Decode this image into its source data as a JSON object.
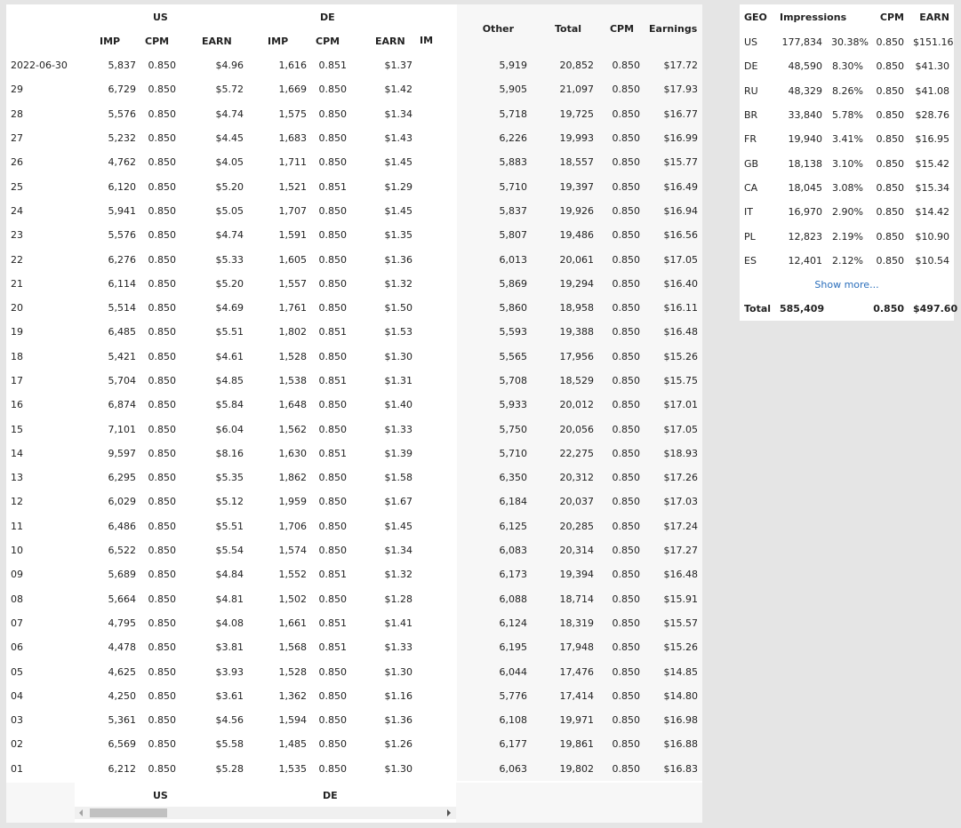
{
  "main": {
    "group_headers": {
      "us": "US",
      "de": "DE",
      "other_trunc": "IM"
    },
    "col_headers": {
      "us_imp": "IMP",
      "us_cpm": "CPM",
      "us_earn": "EARN",
      "de_imp": "IMP",
      "de_cpm": "CPM",
      "de_earn": "EARN",
      "other": "Other",
      "total": "Total",
      "cpm": "CPM",
      "earnings": "Earnings"
    },
    "rows": [
      {
        "date": "2022-06-30",
        "us_imp": "5,837",
        "us_cpm": "0.850",
        "us_earn": "$4.96",
        "de_imp": "1,616",
        "de_cpm": "0.851",
        "de_earn": "$1.37",
        "other": "5,919",
        "total": "20,852",
        "cpm": "0.850",
        "earnings": "$17.72"
      },
      {
        "date": "29",
        "us_imp": "6,729",
        "us_cpm": "0.850",
        "us_earn": "$5.72",
        "de_imp": "1,669",
        "de_cpm": "0.850",
        "de_earn": "$1.42",
        "other": "5,905",
        "total": "21,097",
        "cpm": "0.850",
        "earnings": "$17.93"
      },
      {
        "date": "28",
        "us_imp": "5,576",
        "us_cpm": "0.850",
        "us_earn": "$4.74",
        "de_imp": "1,575",
        "de_cpm": "0.850",
        "de_earn": "$1.34",
        "other": "5,718",
        "total": "19,725",
        "cpm": "0.850",
        "earnings": "$16.77"
      },
      {
        "date": "27",
        "us_imp": "5,232",
        "us_cpm": "0.850",
        "us_earn": "$4.45",
        "de_imp": "1,683",
        "de_cpm": "0.850",
        "de_earn": "$1.43",
        "other": "6,226",
        "total": "19,993",
        "cpm": "0.850",
        "earnings": "$16.99"
      },
      {
        "date": "26",
        "us_imp": "4,762",
        "us_cpm": "0.850",
        "us_earn": "$4.05",
        "de_imp": "1,711",
        "de_cpm": "0.850",
        "de_earn": "$1.45",
        "other": "5,883",
        "total": "18,557",
        "cpm": "0.850",
        "earnings": "$15.77"
      },
      {
        "date": "25",
        "us_imp": "6,120",
        "us_cpm": "0.850",
        "us_earn": "$5.20",
        "de_imp": "1,521",
        "de_cpm": "0.851",
        "de_earn": "$1.29",
        "other": "5,710",
        "total": "19,397",
        "cpm": "0.850",
        "earnings": "$16.49"
      },
      {
        "date": "24",
        "us_imp": "5,941",
        "us_cpm": "0.850",
        "us_earn": "$5.05",
        "de_imp": "1,707",
        "de_cpm": "0.850",
        "de_earn": "$1.45",
        "other": "5,837",
        "total": "19,926",
        "cpm": "0.850",
        "earnings": "$16.94"
      },
      {
        "date": "23",
        "us_imp": "5,576",
        "us_cpm": "0.850",
        "us_earn": "$4.74",
        "de_imp": "1,591",
        "de_cpm": "0.850",
        "de_earn": "$1.35",
        "other": "5,807",
        "total": "19,486",
        "cpm": "0.850",
        "earnings": "$16.56"
      },
      {
        "date": "22",
        "us_imp": "6,276",
        "us_cpm": "0.850",
        "us_earn": "$5.33",
        "de_imp": "1,605",
        "de_cpm": "0.850",
        "de_earn": "$1.36",
        "other": "6,013",
        "total": "20,061",
        "cpm": "0.850",
        "earnings": "$17.05"
      },
      {
        "date": "21",
        "us_imp": "6,114",
        "us_cpm": "0.850",
        "us_earn": "$5.20",
        "de_imp": "1,557",
        "de_cpm": "0.850",
        "de_earn": "$1.32",
        "other": "5,869",
        "total": "19,294",
        "cpm": "0.850",
        "earnings": "$16.40"
      },
      {
        "date": "20",
        "us_imp": "5,514",
        "us_cpm": "0.850",
        "us_earn": "$4.69",
        "de_imp": "1,761",
        "de_cpm": "0.850",
        "de_earn": "$1.50",
        "other": "5,860",
        "total": "18,958",
        "cpm": "0.850",
        "earnings": "$16.11"
      },
      {
        "date": "19",
        "us_imp": "6,485",
        "us_cpm": "0.850",
        "us_earn": "$5.51",
        "de_imp": "1,802",
        "de_cpm": "0.851",
        "de_earn": "$1.53",
        "other": "5,593",
        "total": "19,388",
        "cpm": "0.850",
        "earnings": "$16.48"
      },
      {
        "date": "18",
        "us_imp": "5,421",
        "us_cpm": "0.850",
        "us_earn": "$4.61",
        "de_imp": "1,528",
        "de_cpm": "0.850",
        "de_earn": "$1.30",
        "other": "5,565",
        "total": "17,956",
        "cpm": "0.850",
        "earnings": "$15.26"
      },
      {
        "date": "17",
        "us_imp": "5,704",
        "us_cpm": "0.850",
        "us_earn": "$4.85",
        "de_imp": "1,538",
        "de_cpm": "0.851",
        "de_earn": "$1.31",
        "other": "5,708",
        "total": "18,529",
        "cpm": "0.850",
        "earnings": "$15.75"
      },
      {
        "date": "16",
        "us_imp": "6,874",
        "us_cpm": "0.850",
        "us_earn": "$5.84",
        "de_imp": "1,648",
        "de_cpm": "0.850",
        "de_earn": "$1.40",
        "other": "5,933",
        "total": "20,012",
        "cpm": "0.850",
        "earnings": "$17.01"
      },
      {
        "date": "15",
        "us_imp": "7,101",
        "us_cpm": "0.850",
        "us_earn": "$6.04",
        "de_imp": "1,562",
        "de_cpm": "0.850",
        "de_earn": "$1.33",
        "other": "5,750",
        "total": "20,056",
        "cpm": "0.850",
        "earnings": "$17.05"
      },
      {
        "date": "14",
        "us_imp": "9,597",
        "us_cpm": "0.850",
        "us_earn": "$8.16",
        "de_imp": "1,630",
        "de_cpm": "0.851",
        "de_earn": "$1.39",
        "other": "5,710",
        "total": "22,275",
        "cpm": "0.850",
        "earnings": "$18.93"
      },
      {
        "date": "13",
        "us_imp": "6,295",
        "us_cpm": "0.850",
        "us_earn": "$5.35",
        "de_imp": "1,862",
        "de_cpm": "0.850",
        "de_earn": "$1.58",
        "other": "6,350",
        "total": "20,312",
        "cpm": "0.850",
        "earnings": "$17.26"
      },
      {
        "date": "12",
        "us_imp": "6,029",
        "us_cpm": "0.850",
        "us_earn": "$5.12",
        "de_imp": "1,959",
        "de_cpm": "0.850",
        "de_earn": "$1.67",
        "other": "6,184",
        "total": "20,037",
        "cpm": "0.850",
        "earnings": "$17.03"
      },
      {
        "date": "11",
        "us_imp": "6,486",
        "us_cpm": "0.850",
        "us_earn": "$5.51",
        "de_imp": "1,706",
        "de_cpm": "0.850",
        "de_earn": "$1.45",
        "other": "6,125",
        "total": "20,285",
        "cpm": "0.850",
        "earnings": "$17.24"
      },
      {
        "date": "10",
        "us_imp": "6,522",
        "us_cpm": "0.850",
        "us_earn": "$5.54",
        "de_imp": "1,574",
        "de_cpm": "0.850",
        "de_earn": "$1.34",
        "other": "6,083",
        "total": "20,314",
        "cpm": "0.850",
        "earnings": "$17.27"
      },
      {
        "date": "09",
        "us_imp": "5,689",
        "us_cpm": "0.850",
        "us_earn": "$4.84",
        "de_imp": "1,552",
        "de_cpm": "0.851",
        "de_earn": "$1.32",
        "other": "6,173",
        "total": "19,394",
        "cpm": "0.850",
        "earnings": "$16.48"
      },
      {
        "date": "08",
        "us_imp": "5,664",
        "us_cpm": "0.850",
        "us_earn": "$4.81",
        "de_imp": "1,502",
        "de_cpm": "0.850",
        "de_earn": "$1.28",
        "other": "6,088",
        "total": "18,714",
        "cpm": "0.850",
        "earnings": "$15.91"
      },
      {
        "date": "07",
        "us_imp": "4,795",
        "us_cpm": "0.850",
        "us_earn": "$4.08",
        "de_imp": "1,661",
        "de_cpm": "0.851",
        "de_earn": "$1.41",
        "other": "6,124",
        "total": "18,319",
        "cpm": "0.850",
        "earnings": "$15.57"
      },
      {
        "date": "06",
        "us_imp": "4,478",
        "us_cpm": "0.850",
        "us_earn": "$3.81",
        "de_imp": "1,568",
        "de_cpm": "0.851",
        "de_earn": "$1.33",
        "other": "6,195",
        "total": "17,948",
        "cpm": "0.850",
        "earnings": "$15.26"
      },
      {
        "date": "05",
        "us_imp": "4,625",
        "us_cpm": "0.850",
        "us_earn": "$3.93",
        "de_imp": "1,528",
        "de_cpm": "0.850",
        "de_earn": "$1.30",
        "other": "6,044",
        "total": "17,476",
        "cpm": "0.850",
        "earnings": "$14.85"
      },
      {
        "date": "04",
        "us_imp": "4,250",
        "us_cpm": "0.850",
        "us_earn": "$3.61",
        "de_imp": "1,362",
        "de_cpm": "0.850",
        "de_earn": "$1.16",
        "other": "5,776",
        "total": "17,414",
        "cpm": "0.850",
        "earnings": "$14.80"
      },
      {
        "date": "03",
        "us_imp": "5,361",
        "us_cpm": "0.850",
        "us_earn": "$4.56",
        "de_imp": "1,594",
        "de_cpm": "0.850",
        "de_earn": "$1.36",
        "other": "6,108",
        "total": "19,971",
        "cpm": "0.850",
        "earnings": "$16.98"
      },
      {
        "date": "02",
        "us_imp": "6,569",
        "us_cpm": "0.850",
        "us_earn": "$5.58",
        "de_imp": "1,485",
        "de_cpm": "0.850",
        "de_earn": "$1.26",
        "other": "6,177",
        "total": "19,861",
        "cpm": "0.850",
        "earnings": "$16.88"
      },
      {
        "date": "01",
        "us_imp": "6,212",
        "us_cpm": "0.850",
        "us_earn": "$5.28",
        "de_imp": "1,535",
        "de_cpm": "0.850",
        "de_earn": "$1.30",
        "other": "6,063",
        "total": "19,802",
        "cpm": "0.850",
        "earnings": "$16.83"
      }
    ],
    "footer": {
      "us": "US",
      "de": "DE"
    }
  },
  "geo": {
    "headers": {
      "geo": "GEO",
      "impressions": "Impressions",
      "cpm": "CPM",
      "earn": "EARN"
    },
    "rows": [
      {
        "geo": "US",
        "imp": "177,834",
        "pct": "30.38%",
        "cpm": "0.850",
        "earn": "$151.16"
      },
      {
        "geo": "DE",
        "imp": "48,590",
        "pct": "8.30%",
        "cpm": "0.850",
        "earn": "$41.30"
      },
      {
        "geo": "RU",
        "imp": "48,329",
        "pct": "8.26%",
        "cpm": "0.850",
        "earn": "$41.08"
      },
      {
        "geo": "BR",
        "imp": "33,840",
        "pct": "5.78%",
        "cpm": "0.850",
        "earn": "$28.76"
      },
      {
        "geo": "FR",
        "imp": "19,940",
        "pct": "3.41%",
        "cpm": "0.850",
        "earn": "$16.95"
      },
      {
        "geo": "GB",
        "imp": "18,138",
        "pct": "3.10%",
        "cpm": "0.850",
        "earn": "$15.42"
      },
      {
        "geo": "CA",
        "imp": "18,045",
        "pct": "3.08%",
        "cpm": "0.850",
        "earn": "$15.34"
      },
      {
        "geo": "IT",
        "imp": "16,970",
        "pct": "2.90%",
        "cpm": "0.850",
        "earn": "$14.42"
      },
      {
        "geo": "PL",
        "imp": "12,823",
        "pct": "2.19%",
        "cpm": "0.850",
        "earn": "$10.90"
      },
      {
        "geo": "ES",
        "imp": "12,401",
        "pct": "2.12%",
        "cpm": "0.850",
        "earn": "$10.54"
      }
    ],
    "show_more": "Show more...",
    "total": {
      "label": "Total",
      "imp": "585,409",
      "cpm": "0.850",
      "earn": "$497.60"
    }
  },
  "colors": {
    "link": "#2a6ebb",
    "page_bg": "#e5e5e5",
    "panel_bg": "#ffffff",
    "muted_bg": "#f7f7f7"
  }
}
